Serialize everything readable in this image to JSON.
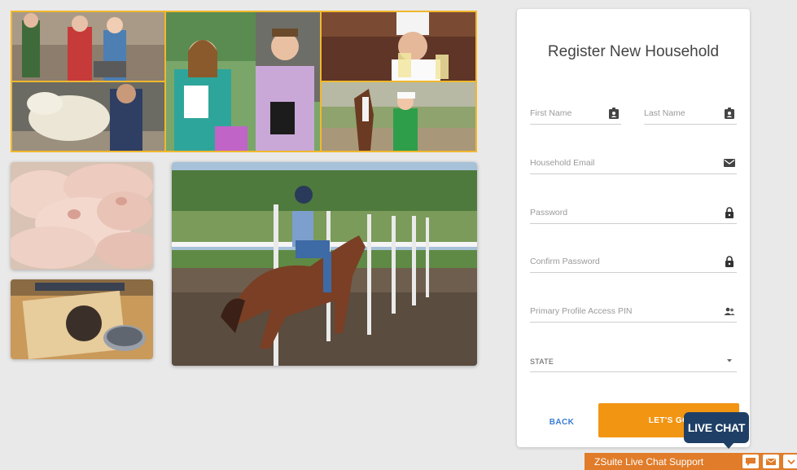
{
  "register": {
    "title": "Register New Household",
    "fields": {
      "first_name": "First Name",
      "last_name": "Last Name",
      "email": "Household Email",
      "password": "Password",
      "confirm_password": "Confirm Password",
      "pin": "Primary Profile Access PIN",
      "state": "STATE"
    },
    "back_label": "BACK",
    "submit_label": "LET'S GO"
  },
  "chat": {
    "bubble_label": "LIVE CHAT",
    "bar_label": "ZSuite Live Chat Support"
  },
  "icons": {
    "first_name": "contact-badge-icon",
    "last_name": "contact-badge-icon",
    "email": "envelope-icon",
    "password": "lock-icon",
    "confirm_password": "lock-icon",
    "pin": "people-icon",
    "state": "dropdown-arrow-icon"
  },
  "colors": {
    "accent": "#f29512",
    "back_link": "#3a7bd5",
    "collage_border": "#f1b82d",
    "chat_bubble": "#1f3f66",
    "chat_bar": "#e07c2a"
  }
}
